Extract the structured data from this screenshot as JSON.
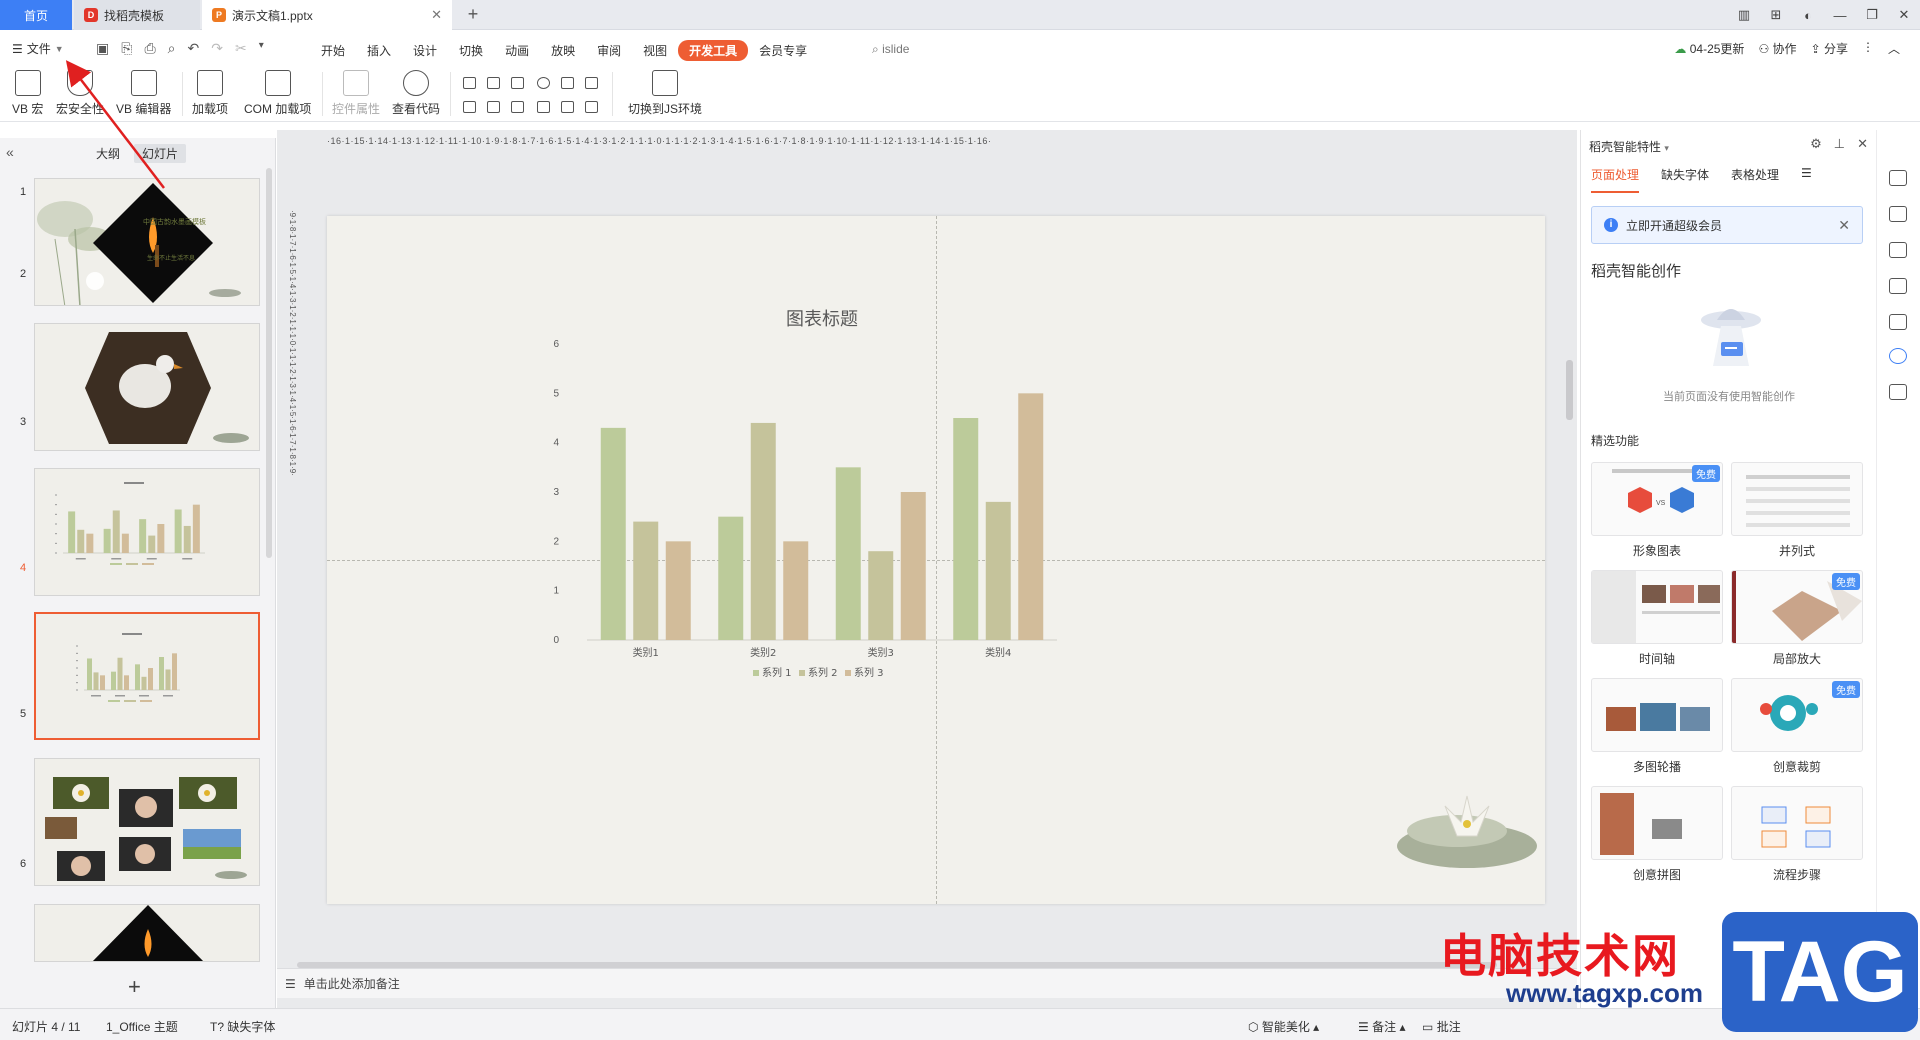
{
  "tabs": {
    "home": "首页",
    "templates": "找稻壳模板",
    "document": "演示文稿1.pptx"
  },
  "menu": {
    "file": "文件",
    "tabs": [
      "开始",
      "插入",
      "设计",
      "切换",
      "动画",
      "放映",
      "审阅",
      "视图",
      "开发工具",
      "会员专享"
    ],
    "active_tab": "开发工具",
    "search": "islide",
    "update": "04-25更新",
    "collab": "协作",
    "share": "分享"
  },
  "ribbon": {
    "vb_macro": "VB 宏",
    "macro_security": "宏安全性",
    "vb_editor": "VB 编辑器",
    "addins": "加载项",
    "com_addins": "COM 加载项",
    "control_props": "控件属性",
    "view_code": "查看代码",
    "switch_js": "切换到JS环境"
  },
  "left_panel": {
    "outline_tab": "大纲",
    "slides_tab": "幻灯片",
    "slide_numbers": [
      "1",
      "2",
      "3",
      "4",
      "5",
      "6"
    ],
    "slide1_title": "中国古韵水墨画模板",
    "slide1_sub": "生命不止生活不息"
  },
  "slide": {
    "chart_title": "图表标题"
  },
  "chart_data": {
    "type": "bar",
    "title": "图表标题",
    "categories": [
      "类别1",
      "类别2",
      "类别3",
      "类别4"
    ],
    "series": [
      {
        "name": "系列 1",
        "values": [
          4.3,
          2.5,
          3.5,
          4.5
        ],
        "color": "#bccb9a"
      },
      {
        "name": "系列 2",
        "values": [
          2.4,
          4.4,
          1.8,
          2.8
        ],
        "color": "#c5c39b"
      },
      {
        "name": "系列 3",
        "values": [
          2.0,
          2.0,
          3.0,
          5.0
        ],
        "color": "#d2bc9a"
      }
    ],
    "ylim": [
      0,
      6
    ],
    "yticks": [
      "0",
      "1",
      "2",
      "3",
      "4",
      "5",
      "6"
    ],
    "legend": "bottom",
    "grid": false
  },
  "notes_placeholder": "单击此处添加备注",
  "right_panel": {
    "header": "稻壳智能特性",
    "tabs": [
      "页面处理",
      "缺失字体",
      "表格处理"
    ],
    "active_tab": "页面处理",
    "vip_banner": "立即开通超级会员",
    "ai_title": "稻壳智能创作",
    "ai_empty": "当前页面没有使用智能创作",
    "featured_label": "精选功能",
    "free_badge": "免费",
    "features": [
      "形象图表",
      "并列式",
      "时间轴",
      "局部放大",
      "多图轮播",
      "创意裁剪",
      "创意拼图",
      "流程步骤"
    ]
  },
  "status": {
    "slide_counter": "幻灯片 4 / 11",
    "theme": "1_Office 主题",
    "missing_fonts": "缺失字体",
    "smart_beautify": "智能美化",
    "notes": "备注",
    "comments": "批注"
  },
  "watermark": {
    "text": "电脑技术网",
    "url": "www.tagxp.com",
    "tag": "TAG"
  },
  "colors": {
    "accent": "#ee5d33",
    "tab_blue": "#3d7ff5"
  }
}
